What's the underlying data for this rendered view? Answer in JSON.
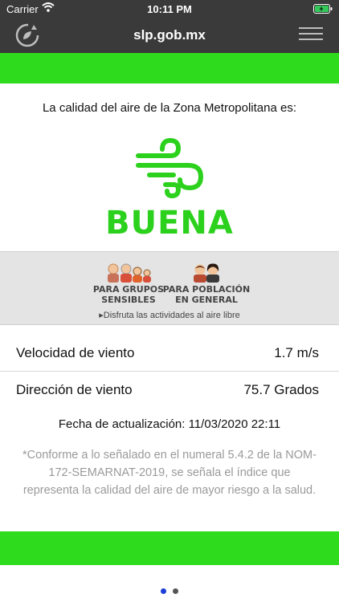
{
  "status_bar": {
    "carrier": "Carrier",
    "time": "10:11 PM",
    "wifi_icon": "wifi-icon",
    "battery_icon": "battery-charging-icon"
  },
  "nav": {
    "title": "slp.gob.mx",
    "refresh_icon": "refresh-icon",
    "menu_icon": "hamburger-menu-icon"
  },
  "colors": {
    "nav_bg": "#3a3a3a",
    "accent_green": "#2edc1d",
    "quality_green": "#2bd11c",
    "page_dot_active": "#1e3fd6",
    "page_dot_inactive": "#555555"
  },
  "air_quality": {
    "intro": "La calidad del aire de la Zona Metropolitana es:",
    "level": "BUENA",
    "level_icon": "wind-icon"
  },
  "groups": {
    "sensitive_line1": "PARA GRUPOS",
    "sensitive_line2": "SENSIBLES",
    "general_line1": "PARA POBLACIÓN",
    "general_line2": "EN GENERAL",
    "note": "▸Disfruta las actividades al aire libre"
  },
  "wind": {
    "speed_label": "Velocidad de viento",
    "speed_value": "1.7 m/s",
    "direction_label": "Dirección de viento",
    "direction_value": "75.7 Grados"
  },
  "updated": "Fecha de actualización: 11/03/2020 22:11",
  "disclaimer": "*Conforme a lo señalado en el numeral 5.4.2 de la NOM-172-SEMARNAT-2019, se señala el índice que representa la calidad del aire de mayor riesgo a la salud.",
  "pager": {
    "pages": 2,
    "current": 1
  }
}
